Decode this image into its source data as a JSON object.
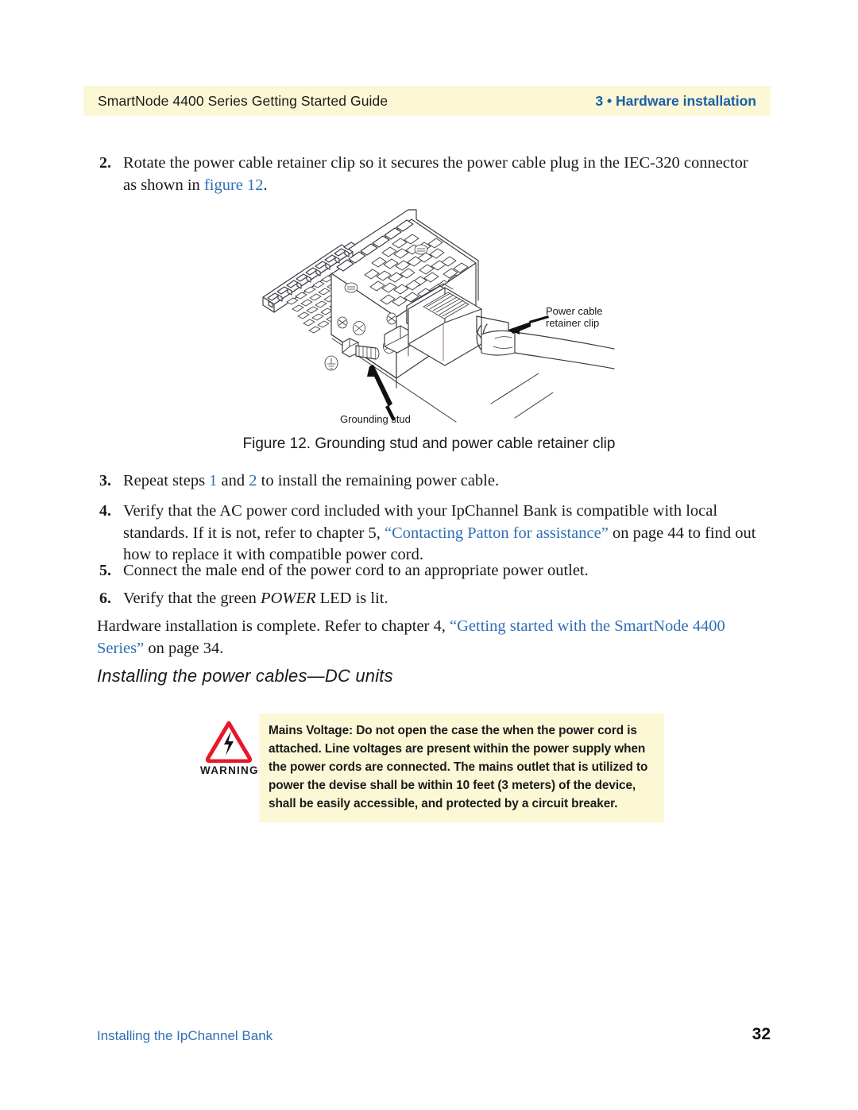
{
  "header": {
    "left_text": "SmartNode 4400 Series Getting Started Guide",
    "right_text": "3 • Hardware installation",
    "band_color": "#fcf8d6",
    "accent_blue": "#1a5fa8"
  },
  "steps": [
    {
      "number": "2.",
      "text_before": "Rotate the power cable retainer clip so it secures the power cable plug in the IEC-320 connector as shown in ",
      "link": "figure 12",
      "text_after": "."
    },
    {
      "number": "3.",
      "seg1": "Repeat steps ",
      "link1": "1",
      "seg2": " and ",
      "link2": "2",
      "seg3": " to install the remaining power cable."
    },
    {
      "number": "4.",
      "seg1": "Verify that the AC power cord included with your IpChannel Bank is compatible with local standards. If it is not, refer to chapter 5, ",
      "link1": "“Contacting Patton for assistance”",
      "seg2": " on page 44 to find out how to replace it with compatible power cord."
    },
    {
      "number": "5.",
      "text": "Connect the male end of the power cord to an appropriate power outlet."
    },
    {
      "number": "6.",
      "seg1": "Verify that the green ",
      "italic": "POWER",
      "seg2": " LED is lit."
    }
  ],
  "closing_paragraph": {
    "seg1": "Hardware installation is complete. Refer to chapter 4, ",
    "link": "“Getting started with the SmartNode 4400 Series”",
    "seg2": " on page 34."
  },
  "figure": {
    "caption": "Figure 12. Grounding stud and power cable retainer clip",
    "callout_retainer": "Power cable\nretainer clip",
    "callout_grounding": "Grounding stud",
    "line_color": "#3a3a42"
  },
  "section_heading": "Installing the power cables—DC units",
  "warning": {
    "label": "WARNING",
    "icon": "warning-triangle-lightning-icon",
    "triangle_color": "#e8182b",
    "box_color": "#fcf8d6",
    "text": "Mains Voltage: Do not open the case the when the power cord is attached. Line voltages are present within the power supply when the power cords are connected. The mains outlet that is utilized to power the devise shall be within 10 feet (3 meters) of the device, shall be easily accessible, and protected by a circuit breaker."
  },
  "footer": {
    "left_text": "Installing the IpChannel Bank",
    "page_number": "32",
    "link_color": "#2f6fb5"
  }
}
